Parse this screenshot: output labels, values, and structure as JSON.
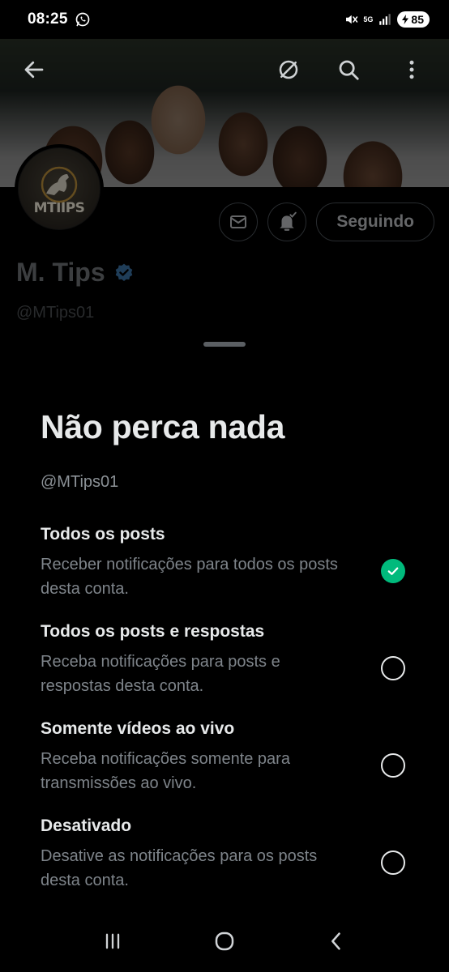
{
  "status_bar": {
    "time": "08:25",
    "network": "5G",
    "battery": "85",
    "icons": [
      "whatsapp-icon",
      "mute-icon",
      "signal-icon",
      "battery-icon"
    ]
  },
  "header": {
    "icons": [
      "back-arrow-icon",
      "grok-icon",
      "search-icon",
      "more-vert-icon"
    ]
  },
  "profile": {
    "avatar_text": "MTIIPS",
    "name": "M. Tips",
    "handle": "@MTips01",
    "following_label": "Seguindo",
    "verified_color": "#1d9bf0"
  },
  "sheet": {
    "title": "Não perca nada",
    "handle": "@MTips01",
    "options": [
      {
        "title": "Todos os posts",
        "description": "Receber notificações para todos os posts desta conta.",
        "selected": true
      },
      {
        "title": "Todos os posts e respostas",
        "description": "Receba notificações para posts e respostas desta conta.",
        "selected": false
      },
      {
        "title": "Somente vídeos ao vivo",
        "description": "Receba notificações somente para transmissões ao vivo.",
        "selected": false
      },
      {
        "title": "Desativado",
        "description": "Desative as notificações para os posts desta conta.",
        "selected": false
      }
    ]
  },
  "colors": {
    "accent_selected": "#00ba7c",
    "background": "#000000"
  },
  "nav_bar": {
    "icons": [
      "recents-icon",
      "home-icon",
      "back-icon"
    ]
  }
}
